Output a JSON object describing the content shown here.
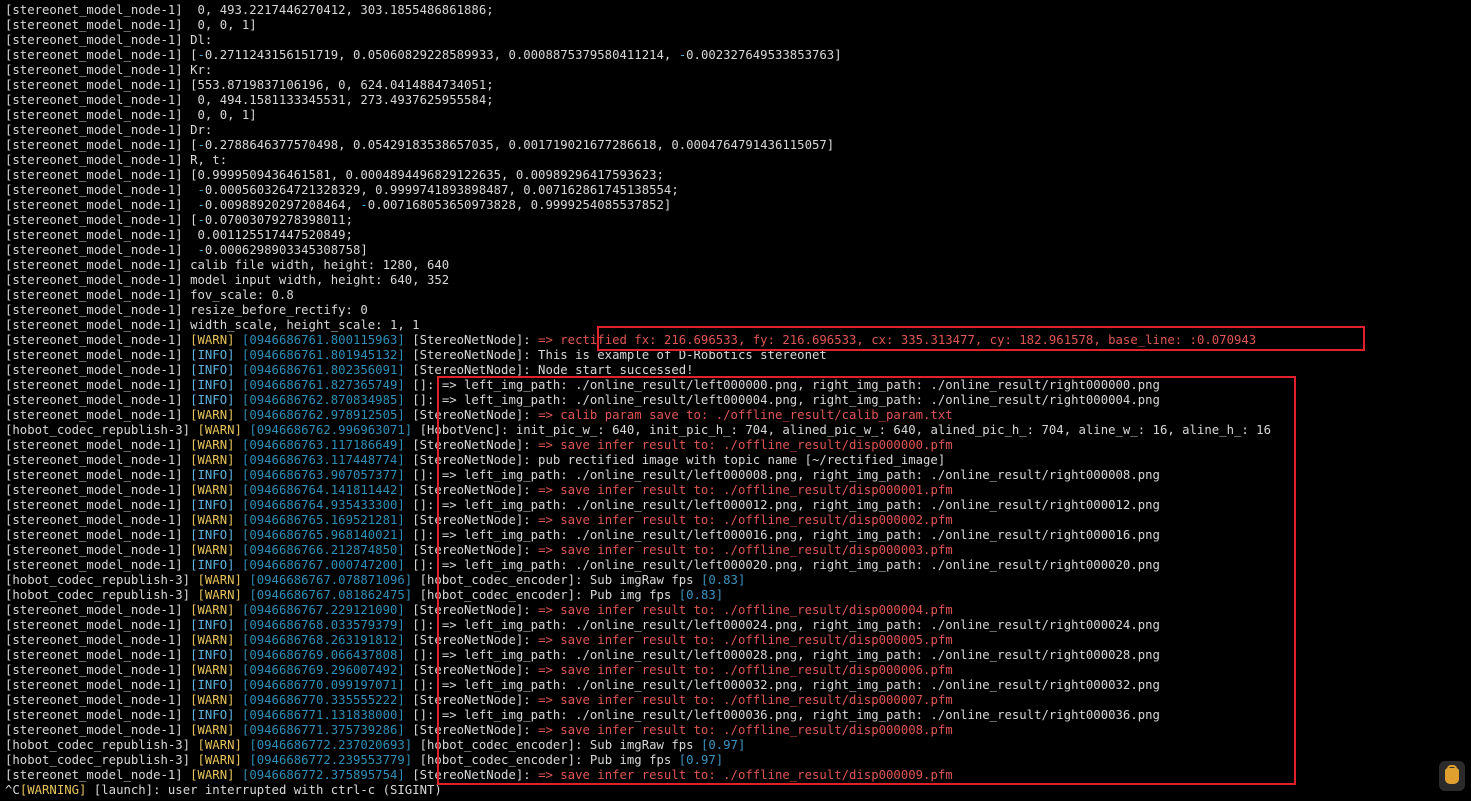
{
  "colors": {
    "background": "#000000",
    "text": "#d8d8d8",
    "warn_level": "#e6c35c",
    "info_level": "#5fb3df",
    "timestamp": "#2f8fb6",
    "highlight_red": "#e05555",
    "annotation_box": "#e0202a"
  },
  "terminal": {
    "lines": [
      [
        {
          "t": "[stereonet_model_node-1]  0, 493.2217446270412, 303.1855486861886;",
          "c": "text"
        }
      ],
      [
        {
          "t": "[stereonet_model_node-1]  0, 0, 1]",
          "c": "text"
        }
      ],
      [
        {
          "t": "[stereonet_model_node-1] Dl:",
          "c": "text"
        }
      ],
      [
        {
          "t": "[stereonet_model_node-1] [",
          "c": "text"
        },
        {
          "t": "-",
          "c": "neg"
        },
        {
          "t": "0.2711243156151719, 0.05060829228589933, 0.0008875379580411214, ",
          "c": "text"
        },
        {
          "t": "-",
          "c": "neg"
        },
        {
          "t": "0.002327649533853763]",
          "c": "text"
        }
      ],
      [
        {
          "t": "[stereonet_model_node-1] Kr:",
          "c": "text"
        }
      ],
      [
        {
          "t": "[stereonet_model_node-1] [553.8719837106196, 0, 624.0414884734051;",
          "c": "text"
        }
      ],
      [
        {
          "t": "[stereonet_model_node-1]  0, 494.1581133345531, 273.4937625955584;",
          "c": "text"
        }
      ],
      [
        {
          "t": "[stereonet_model_node-1]  0, 0, 1]",
          "c": "text"
        }
      ],
      [
        {
          "t": "[stereonet_model_node-1] Dr:",
          "c": "text"
        }
      ],
      [
        {
          "t": "[stereonet_model_node-1] [",
          "c": "text"
        },
        {
          "t": "-",
          "c": "neg"
        },
        {
          "t": "0.2788646377570498, 0.05429183538657035, 0.001719021677286618, 0.0004764791436115057]",
          "c": "text"
        }
      ],
      [
        {
          "t": "[stereonet_model_node-1] R, t:",
          "c": "text"
        }
      ],
      [
        {
          "t": "[stereonet_model_node-1] [0.9999509436461581, 0.0004894496829122635, 0.00989296417593623;",
          "c": "text"
        }
      ],
      [
        {
          "t": "[stereonet_model_node-1]  ",
          "c": "text"
        },
        {
          "t": "-",
          "c": "neg"
        },
        {
          "t": "0.0005603264721328329, 0.9999741893898487, 0.007162861745138554;",
          "c": "text"
        }
      ],
      [
        {
          "t": "[stereonet_model_node-1]  ",
          "c": "text"
        },
        {
          "t": "-",
          "c": "neg"
        },
        {
          "t": "0.00988920297208464, ",
          "c": "text"
        },
        {
          "t": "-",
          "c": "neg"
        },
        {
          "t": "0.007168053650973828, 0.9999254085537852]",
          "c": "text"
        }
      ],
      [
        {
          "t": "[stereonet_model_node-1] [",
          "c": "text"
        },
        {
          "t": "-",
          "c": "neg"
        },
        {
          "t": "0.07003079278398011;",
          "c": "text"
        }
      ],
      [
        {
          "t": "[stereonet_model_node-1]  0.001125517447520849;",
          "c": "text"
        }
      ],
      [
        {
          "t": "[stereonet_model_node-1]  ",
          "c": "text"
        },
        {
          "t": "-",
          "c": "neg"
        },
        {
          "t": "0.0006298903345308758]",
          "c": "text"
        }
      ],
      [
        {
          "t": "[stereonet_model_node-1] calib file width, height: 1280, 640",
          "c": "text"
        }
      ],
      [
        {
          "t": "[stereonet_model_node-1] model input width, height: 640, 352",
          "c": "text"
        }
      ],
      [
        {
          "t": "[stereonet_model_node-1] fov_scale: 0.8",
          "c": "text"
        }
      ],
      [
        {
          "t": "[stereonet_model_node-1] resize_before_rectify: 0",
          "c": "text"
        }
      ],
      [
        {
          "t": "[stereonet_model_node-1] width_scale, height_scale: 1, 1",
          "c": "text"
        }
      ],
      [
        {
          "t": "[stereonet_model_node-1] ",
          "c": "text"
        },
        {
          "t": "[WARN]",
          "c": "warn"
        },
        {
          "t": " ",
          "c": "text"
        },
        {
          "t": "[0946686761.800115963]",
          "c": "ts"
        },
        {
          "t": " [StereoNetNode]: ",
          "c": "text"
        },
        {
          "t": "=> rectified fx: 216.696533, fy: 216.696533, cx: 335.313477, cy: 182.961578, base_line: :0.070943",
          "c": "red"
        }
      ],
      [
        {
          "t": "[stereonet_model_node-1] ",
          "c": "text"
        },
        {
          "t": "[INFO]",
          "c": "info"
        },
        {
          "t": " ",
          "c": "text"
        },
        {
          "t": "[0946686761.801945132]",
          "c": "ts"
        },
        {
          "t": " [StereoNetNode]: This is example of D-Robotics stereonet",
          "c": "text"
        }
      ],
      [
        {
          "t": "[stereonet_model_node-1] ",
          "c": "text"
        },
        {
          "t": "[INFO]",
          "c": "info"
        },
        {
          "t": " ",
          "c": "text"
        },
        {
          "t": "[0946686761.802356091]",
          "c": "ts"
        },
        {
          "t": " [StereoNetNode]: Node start successed!",
          "c": "text"
        }
      ],
      [
        {
          "t": "[stereonet_model_node-1] ",
          "c": "text"
        },
        {
          "t": "[INFO]",
          "c": "info"
        },
        {
          "t": " ",
          "c": "text"
        },
        {
          "t": "[0946686761.827365749]",
          "c": "ts"
        },
        {
          "t": " []: => left_img_path: ./online_result/left000000.png, right_img_path: ./online_result/right000000.png",
          "c": "text"
        }
      ],
      [
        {
          "t": "[stereonet_model_node-1] ",
          "c": "text"
        },
        {
          "t": "[INFO]",
          "c": "info"
        },
        {
          "t": " ",
          "c": "text"
        },
        {
          "t": "[0946686762.870834985]",
          "c": "ts"
        },
        {
          "t": " []: => left_img_path: ./online_result/left000004.png, right_img_path: ./online_result/right000004.png",
          "c": "text"
        }
      ],
      [
        {
          "t": "[stereonet_model_node-1] ",
          "c": "text"
        },
        {
          "t": "[WARN]",
          "c": "warn"
        },
        {
          "t": " ",
          "c": "text"
        },
        {
          "t": "[0946686762.978912505]",
          "c": "ts"
        },
        {
          "t": " [StereoNetNode]: ",
          "c": "text"
        },
        {
          "t": "=> calib param save to: ./offline_result/calib_param.txt",
          "c": "red"
        }
      ],
      [
        {
          "t": "[hobot_codec_republish-3] ",
          "c": "text"
        },
        {
          "t": "[WARN]",
          "c": "warn"
        },
        {
          "t": " ",
          "c": "text"
        },
        {
          "t": "[0946686762.996963071]",
          "c": "ts"
        },
        {
          "t": " [HobotVenc]: init_pic_w_: 640, init_pic_h_: 704, alined_pic_w_: 640, alined_pic_h_: 704, aline_w_: 16, aline_h_: 16",
          "c": "text"
        }
      ],
      [
        {
          "t": "[stereonet_model_node-1] ",
          "c": "text"
        },
        {
          "t": "[WARN]",
          "c": "warn"
        },
        {
          "t": " ",
          "c": "text"
        },
        {
          "t": "[0946686763.117186649]",
          "c": "ts"
        },
        {
          "t": " [StereoNetNode]: ",
          "c": "text"
        },
        {
          "t": "=> save infer result to: ./offline_result/disp000000.pfm",
          "c": "red"
        }
      ],
      [
        {
          "t": "[stereonet_model_node-1] ",
          "c": "text"
        },
        {
          "t": "[WARN]",
          "c": "warn"
        },
        {
          "t": " ",
          "c": "text"
        },
        {
          "t": "[0946686763.117448774]",
          "c": "ts"
        },
        {
          "t": " [StereoNetNode]: pub rectified image with topic name [~/rectified_image]",
          "c": "text"
        }
      ],
      [
        {
          "t": "[stereonet_model_node-1] ",
          "c": "text"
        },
        {
          "t": "[INFO]",
          "c": "info"
        },
        {
          "t": " ",
          "c": "text"
        },
        {
          "t": "[0946686763.907057377]",
          "c": "ts"
        },
        {
          "t": " []: => left_img_path: ./online_result/left000008.png, right_img_path: ./online_result/right000008.png",
          "c": "text"
        }
      ],
      [
        {
          "t": "[stereonet_model_node-1] ",
          "c": "text"
        },
        {
          "t": "[WARN]",
          "c": "warn"
        },
        {
          "t": " ",
          "c": "text"
        },
        {
          "t": "[0946686764.141811442]",
          "c": "ts"
        },
        {
          "t": " [StereoNetNode]: ",
          "c": "text"
        },
        {
          "t": "=> save infer result to: ./offline_result/disp000001.pfm",
          "c": "red"
        }
      ],
      [
        {
          "t": "[stereonet_model_node-1] ",
          "c": "text"
        },
        {
          "t": "[INFO]",
          "c": "info"
        },
        {
          "t": " ",
          "c": "text"
        },
        {
          "t": "[0946686764.935433300]",
          "c": "ts"
        },
        {
          "t": " []: => left_img_path: ./online_result/left000012.png, right_img_path: ./online_result/right000012.png",
          "c": "text"
        }
      ],
      [
        {
          "t": "[stereonet_model_node-1] ",
          "c": "text"
        },
        {
          "t": "[WARN]",
          "c": "warn"
        },
        {
          "t": " ",
          "c": "text"
        },
        {
          "t": "[0946686765.169521281]",
          "c": "ts"
        },
        {
          "t": " [StereoNetNode]: ",
          "c": "text"
        },
        {
          "t": "=> save infer result to: ./offline_result/disp000002.pfm",
          "c": "red"
        }
      ],
      [
        {
          "t": "[stereonet_model_node-1] ",
          "c": "text"
        },
        {
          "t": "[INFO]",
          "c": "info"
        },
        {
          "t": " ",
          "c": "text"
        },
        {
          "t": "[0946686765.968140021]",
          "c": "ts"
        },
        {
          "t": " []: => left_img_path: ./online_result/left000016.png, right_img_path: ./online_result/right000016.png",
          "c": "text"
        }
      ],
      [
        {
          "t": "[stereonet_model_node-1] ",
          "c": "text"
        },
        {
          "t": "[WARN]",
          "c": "warn"
        },
        {
          "t": " ",
          "c": "text"
        },
        {
          "t": "[0946686766.212874850]",
          "c": "ts"
        },
        {
          "t": " [StereoNetNode]: ",
          "c": "text"
        },
        {
          "t": "=> save infer result to: ./offline_result/disp000003.pfm",
          "c": "red"
        }
      ],
      [
        {
          "t": "[stereonet_model_node-1] ",
          "c": "text"
        },
        {
          "t": "[INFO]",
          "c": "info"
        },
        {
          "t": " ",
          "c": "text"
        },
        {
          "t": "[0946686767.000747200]",
          "c": "ts"
        },
        {
          "t": " []: => left_img_path: ./online_result/left000020.png, right_img_path: ./online_result/right000020.png",
          "c": "text"
        }
      ],
      [
        {
          "t": "[hobot_codec_republish-3] ",
          "c": "text"
        },
        {
          "t": "[WARN]",
          "c": "warn"
        },
        {
          "t": " ",
          "c": "text"
        },
        {
          "t": "[0946686767.078871096]",
          "c": "ts"
        },
        {
          "t": " [hobot_codec_encoder]: Sub imgRaw fps ",
          "c": "text"
        },
        {
          "t": "[0.83]",
          "c": "num"
        }
      ],
      [
        {
          "t": "[hobot_codec_republish-3] ",
          "c": "text"
        },
        {
          "t": "[WARN]",
          "c": "warn"
        },
        {
          "t": " ",
          "c": "text"
        },
        {
          "t": "[0946686767.081862475]",
          "c": "ts"
        },
        {
          "t": " [hobot_codec_encoder]: Pub img fps ",
          "c": "text"
        },
        {
          "t": "[0.83]",
          "c": "num"
        }
      ],
      [
        {
          "t": "[stereonet_model_node-1] ",
          "c": "text"
        },
        {
          "t": "[WARN]",
          "c": "warn"
        },
        {
          "t": " ",
          "c": "text"
        },
        {
          "t": "[0946686767.229121090]",
          "c": "ts"
        },
        {
          "t": " [StereoNetNode]: ",
          "c": "text"
        },
        {
          "t": "=> save infer result to: ./offline_result/disp000004.pfm",
          "c": "red"
        }
      ],
      [
        {
          "t": "[stereonet_model_node-1] ",
          "c": "text"
        },
        {
          "t": "[INFO]",
          "c": "info"
        },
        {
          "t": " ",
          "c": "text"
        },
        {
          "t": "[0946686768.033579379]",
          "c": "ts"
        },
        {
          "t": " []: => left_img_path: ./online_result/left000024.png, right_img_path: ./online_result/right000024.png",
          "c": "text"
        }
      ],
      [
        {
          "t": "[stereonet_model_node-1] ",
          "c": "text"
        },
        {
          "t": "[WARN]",
          "c": "warn"
        },
        {
          "t": " ",
          "c": "text"
        },
        {
          "t": "[0946686768.263191812]",
          "c": "ts"
        },
        {
          "t": " [StereoNetNode]: ",
          "c": "text"
        },
        {
          "t": "=> save infer result to: ./offline_result/disp000005.pfm",
          "c": "red"
        }
      ],
      [
        {
          "t": "[stereonet_model_node-1] ",
          "c": "text"
        },
        {
          "t": "[INFO]",
          "c": "info"
        },
        {
          "t": " ",
          "c": "text"
        },
        {
          "t": "[0946686769.066437808]",
          "c": "ts"
        },
        {
          "t": " []: => left_img_path: ./online_result/left000028.png, right_img_path: ./online_result/right000028.png",
          "c": "text"
        }
      ],
      [
        {
          "t": "[stereonet_model_node-1] ",
          "c": "text"
        },
        {
          "t": "[WARN]",
          "c": "warn"
        },
        {
          "t": " ",
          "c": "text"
        },
        {
          "t": "[0946686769.296007492]",
          "c": "ts"
        },
        {
          "t": " [StereoNetNode]: ",
          "c": "text"
        },
        {
          "t": "=> save infer result to: ./offline_result/disp000006.pfm",
          "c": "red"
        }
      ],
      [
        {
          "t": "[stereonet_model_node-1] ",
          "c": "text"
        },
        {
          "t": "[INFO]",
          "c": "info"
        },
        {
          "t": " ",
          "c": "text"
        },
        {
          "t": "[0946686770.099197071]",
          "c": "ts"
        },
        {
          "t": " []: => left_img_path: ./online_result/left000032.png, right_img_path: ./online_result/right000032.png",
          "c": "text"
        }
      ],
      [
        {
          "t": "[stereonet_model_node-1] ",
          "c": "text"
        },
        {
          "t": "[WARN]",
          "c": "warn"
        },
        {
          "t": " ",
          "c": "text"
        },
        {
          "t": "[0946686770.335555222]",
          "c": "ts"
        },
        {
          "t": " [StereoNetNode]: ",
          "c": "text"
        },
        {
          "t": "=> save infer result to: ./offline_result/disp000007.pfm",
          "c": "red"
        }
      ],
      [
        {
          "t": "[stereonet_model_node-1] ",
          "c": "text"
        },
        {
          "t": "[INFO]",
          "c": "info"
        },
        {
          "t": " ",
          "c": "text"
        },
        {
          "t": "[0946686771.131838000]",
          "c": "ts"
        },
        {
          "t": " []: => left_img_path: ./online_result/left000036.png, right_img_path: ./online_result/right000036.png",
          "c": "text"
        }
      ],
      [
        {
          "t": "[stereonet_model_node-1] ",
          "c": "text"
        },
        {
          "t": "[WARN]",
          "c": "warn"
        },
        {
          "t": " ",
          "c": "text"
        },
        {
          "t": "[0946686771.375739286]",
          "c": "ts"
        },
        {
          "t": " [StereoNetNode]: ",
          "c": "text"
        },
        {
          "t": "=> save infer result to: ./offline_result/disp000008.pfm",
          "c": "red"
        }
      ],
      [
        {
          "t": "[hobot_codec_republish-3] ",
          "c": "text"
        },
        {
          "t": "[WARN]",
          "c": "warn"
        },
        {
          "t": " ",
          "c": "text"
        },
        {
          "t": "[0946686772.237020693]",
          "c": "ts"
        },
        {
          "t": " [hobot_codec_encoder]: Sub imgRaw fps ",
          "c": "text"
        },
        {
          "t": "[0.97]",
          "c": "num"
        }
      ],
      [
        {
          "t": "[hobot_codec_republish-3] ",
          "c": "text"
        },
        {
          "t": "[WARN]",
          "c": "warn"
        },
        {
          "t": " ",
          "c": "text"
        },
        {
          "t": "[0946686772.239553779]",
          "c": "ts"
        },
        {
          "t": " [hobot_codec_encoder]: Pub img fps ",
          "c": "text"
        },
        {
          "t": "[0.97]",
          "c": "num"
        }
      ],
      [
        {
          "t": "[stereonet_model_node-1] ",
          "c": "text"
        },
        {
          "t": "[WARN]",
          "c": "warn"
        },
        {
          "t": " ",
          "c": "text"
        },
        {
          "t": "[0946686772.375895754]",
          "c": "ts"
        },
        {
          "t": " [StereoNetNode]: ",
          "c": "text"
        },
        {
          "t": "=> save infer result to: ./offline_result/disp000009.pfm",
          "c": "red"
        }
      ],
      [
        {
          "t": "^C",
          "c": "text"
        },
        {
          "t": "[WARNING]",
          "c": "warn"
        },
        {
          "t": " [launch]: user interrupted with ctrl-c (SIGINT)",
          "c": "text"
        }
      ]
    ]
  },
  "assistant_badge": {
    "icon": "assistant-icon"
  }
}
